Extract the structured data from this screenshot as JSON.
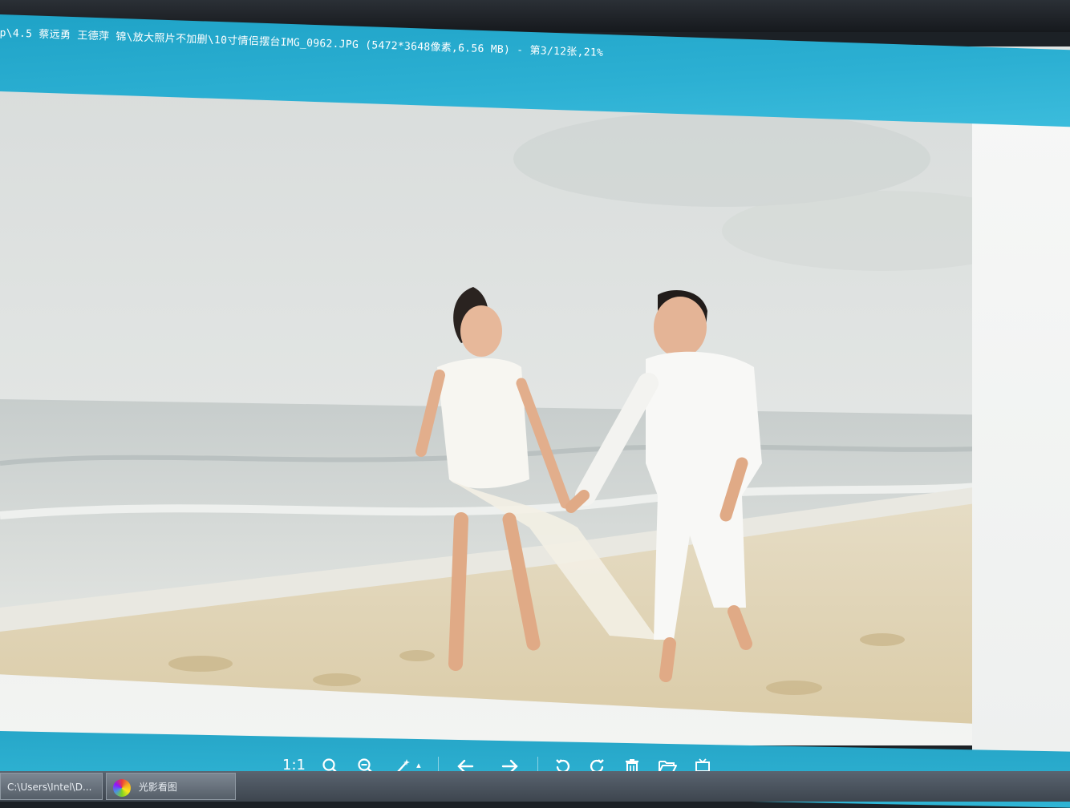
{
  "window": {
    "title": "p\\4.5 蔡远勇 王德萍 锦\\放大照片不加删\\10寸情侣摆台IMG_0962.JPG (5472*3648像素,6.56 MB) - 第3/12张,21%"
  },
  "toolbar": {
    "actual_size_label": "1:1",
    "zoom_in_icon": "magnifier-plus-icon",
    "zoom_out_icon": "magnifier-minus-icon",
    "magic_icon": "magic-wand-icon",
    "magic_caret": "▴",
    "prev_icon": "arrow-left-icon",
    "next_icon": "arrow-right-icon",
    "rotate_left_icon": "rotate-left-icon",
    "rotate_right_icon": "rotate-right-icon",
    "delete_icon": "trash-icon",
    "open_folder_icon": "folder-open-icon",
    "print_icon": "tv-icon"
  },
  "taskbar": {
    "items": [
      {
        "label": "C:\\Users\\Intel\\D..."
      },
      {
        "label": "光影看图"
      }
    ]
  },
  "colors": {
    "accent": "#2cb0d3",
    "toolbar_icon": "#ffffff",
    "taskbar": "#4a535d"
  }
}
